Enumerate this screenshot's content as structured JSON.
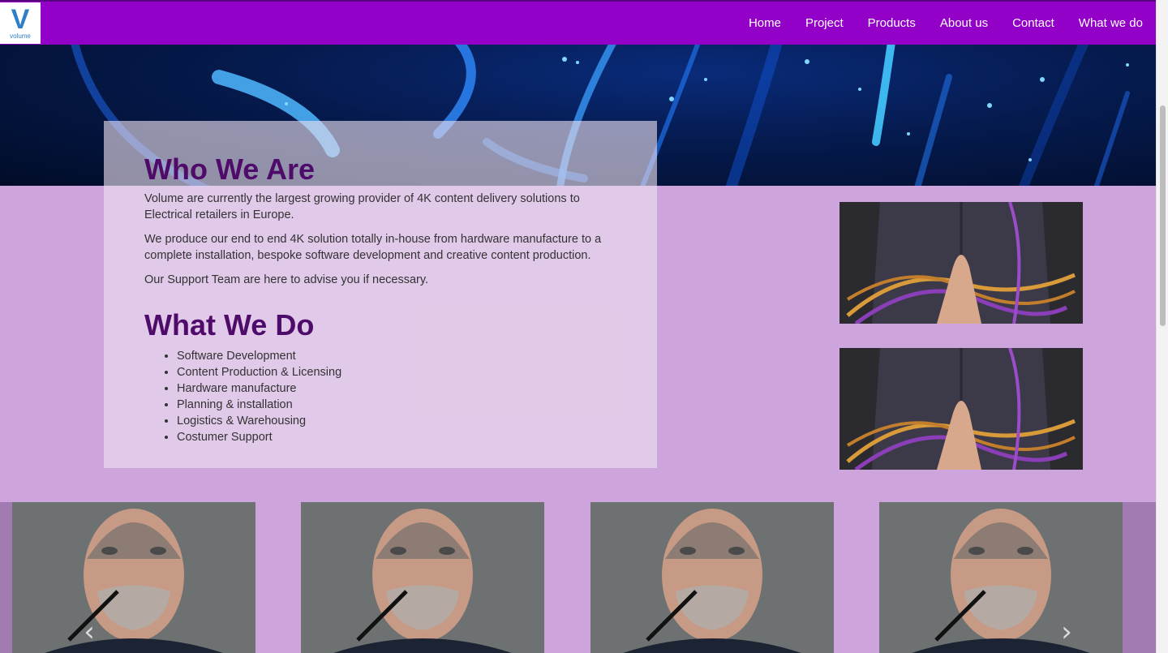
{
  "brand": {
    "logo_letter": "V",
    "logo_word": "volume"
  },
  "nav": {
    "items": [
      "Home",
      "Project",
      "Products",
      "About us",
      "Contact",
      "What we do"
    ]
  },
  "who_we_are": {
    "heading": "Who We Are",
    "paragraphs": [
      "Volume are currently the largest growing provider of 4K content delivery solutions to Electrical retailers in Europe.",
      "We produce our end to end 4K solution totally in-house from hardware manufacture to a complete installation, bespoke software development and creative content production.",
      "Our Support Team are here to advise you if necessary."
    ]
  },
  "what_we_do": {
    "heading": "What We Do",
    "services": [
      "Software Development",
      "Content Production & Licensing",
      "Hardware manufacture",
      "Planning & installation",
      "Logistics & Warehousing",
      "Costumer Support"
    ]
  },
  "carousel": {
    "prev_glyph": "‹",
    "next_glyph": "›"
  },
  "colors": {
    "nav_background": "#9300c8",
    "section_background": "#cda4dc",
    "heading": "#4f0b6a"
  }
}
